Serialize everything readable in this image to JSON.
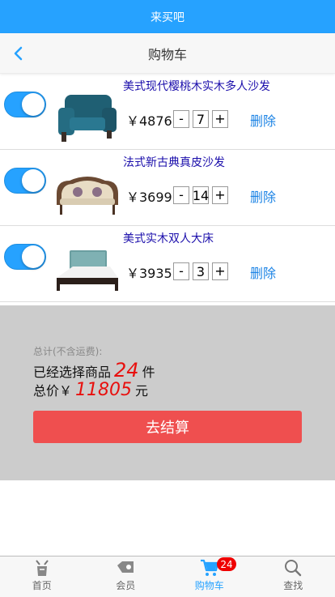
{
  "app": {
    "title": "来买吧"
  },
  "nav": {
    "title": "购物车"
  },
  "items": [
    {
      "name": "美式现代樱桃木实木多人沙发",
      "price": "￥4876",
      "qty": "7",
      "minus": "-",
      "plus": "+",
      "delete": "删除",
      "enabled": true,
      "image": "armchair-icon"
    },
    {
      "name": "法式新古典真皮沙发",
      "price": "￥3699",
      "qty": "14",
      "minus": "-",
      "plus": "+",
      "delete": "删除",
      "enabled": true,
      "image": "sofa-icon"
    },
    {
      "name": "美式实木双人大床",
      "price": "￥3935",
      "qty": "3",
      "minus": "-",
      "plus": "+",
      "delete": "删除",
      "enabled": true,
      "image": "bed-icon"
    }
  ],
  "summary": {
    "label": "总计(不含运费):",
    "count_prefix": "已经选择商品",
    "count": "24",
    "count_suffix": "件",
    "total_prefix": "总价￥",
    "total": "11805",
    "total_suffix": "元",
    "checkout": "去结算"
  },
  "tabs": [
    {
      "label": "首页",
      "icon": "home-icon",
      "active": false
    },
    {
      "label": "会员",
      "icon": "member-icon",
      "active": false
    },
    {
      "label": "购物车",
      "icon": "cart-icon",
      "active": true,
      "badge": "24"
    },
    {
      "label": "查找",
      "icon": "search-icon",
      "active": false
    }
  ],
  "colors": {
    "accent": "#26a2ff",
    "danger": "#ef4f4f",
    "highlight": "#e8100e"
  }
}
